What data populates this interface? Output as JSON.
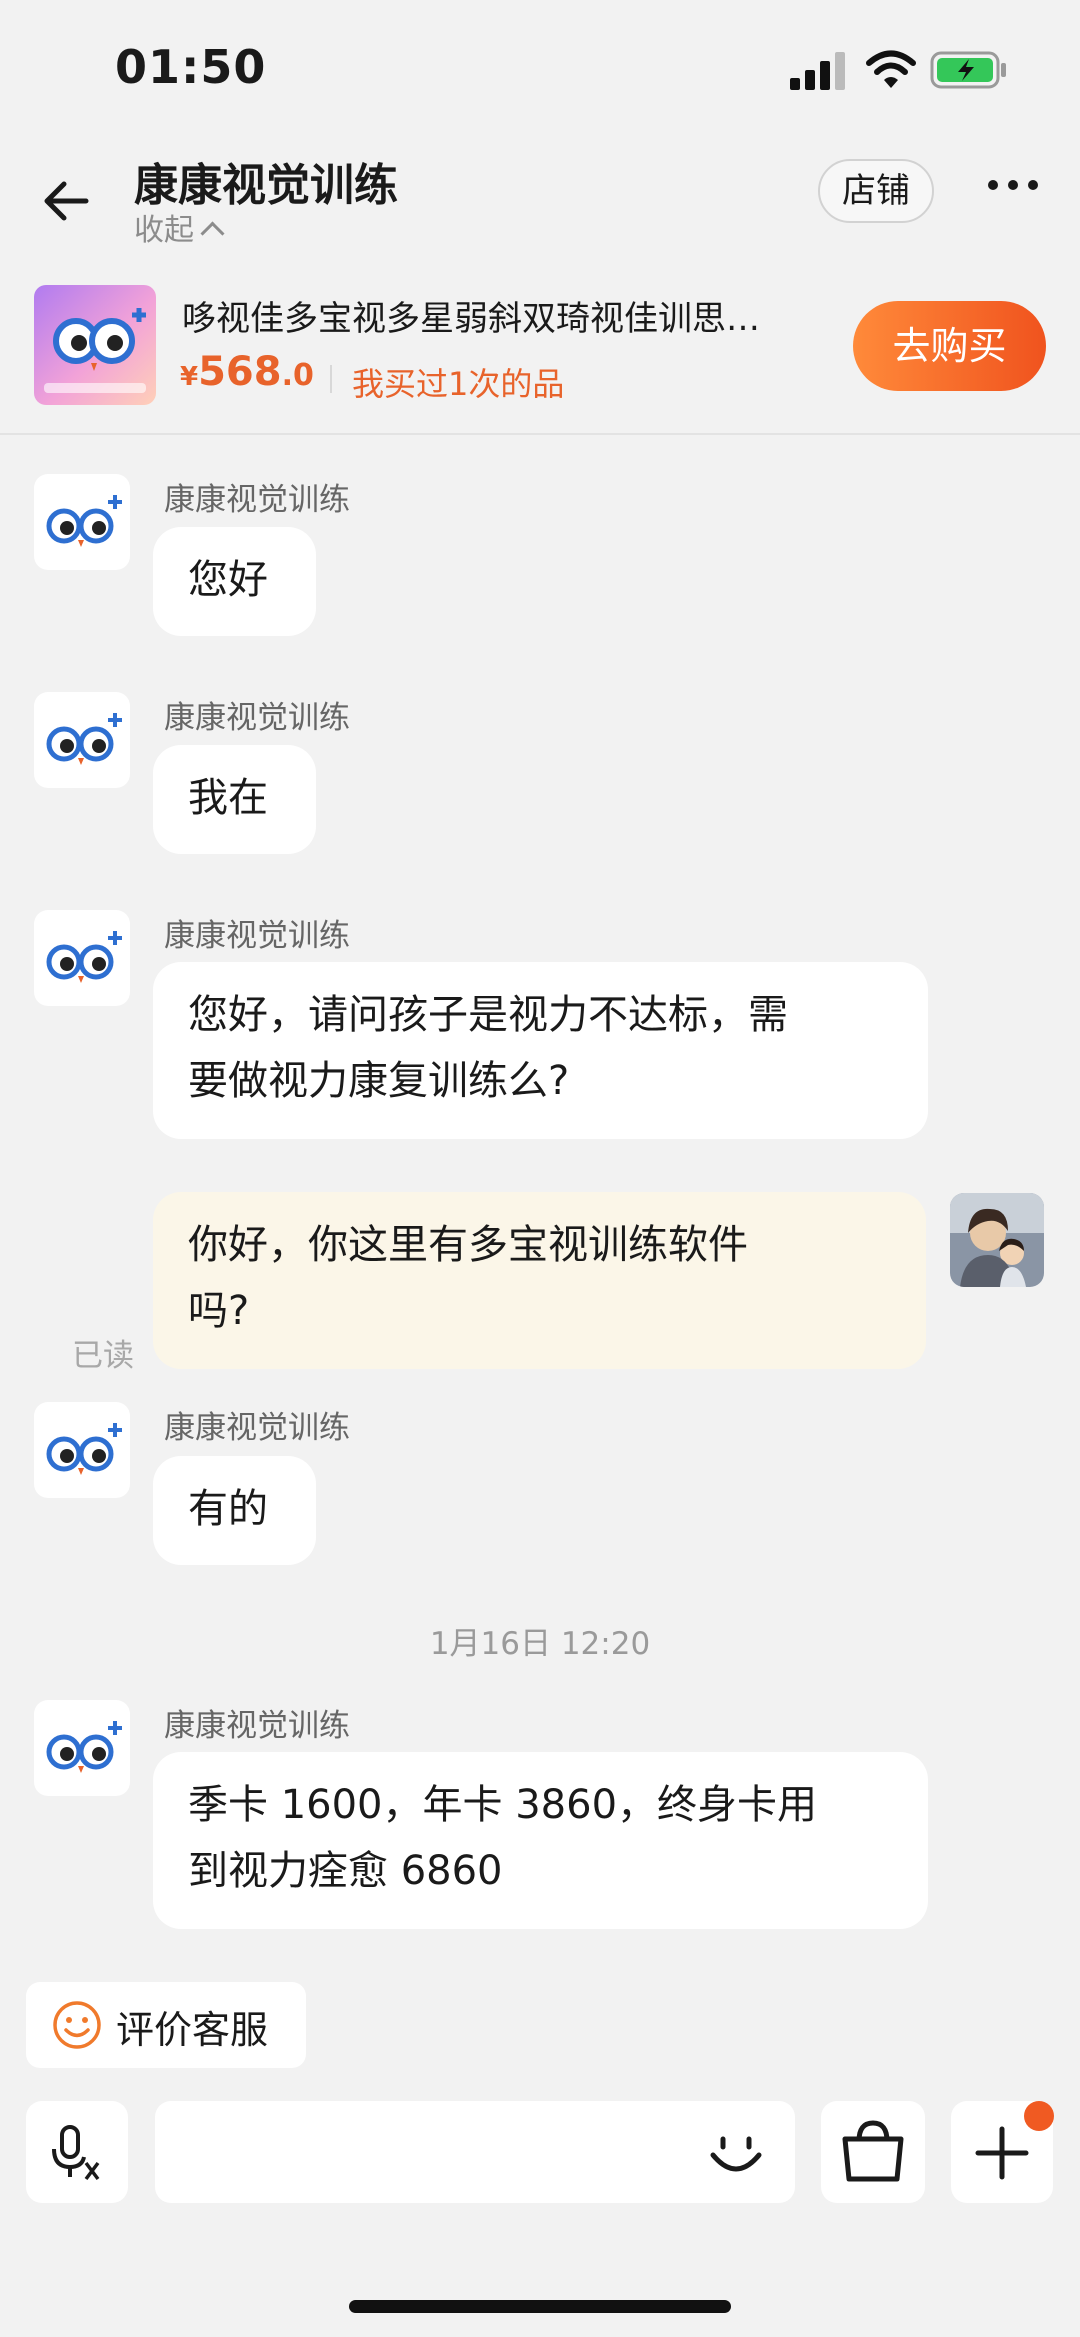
{
  "status_bar": {
    "time": "01:50"
  },
  "header": {
    "title": "康康视觉训练",
    "collapse_label": "收起",
    "store_label": "店铺"
  },
  "product": {
    "name": "哆视佳多宝视多星弱斜双琦视佳训思…",
    "currency": "¥",
    "price_int": "568",
    "price_dec": ".0",
    "purchased_note": "我买过1次的品",
    "buy_label": "去购买"
  },
  "messages": [
    {
      "from": "shop",
      "sender": "康康视觉训练",
      "text": "您好"
    },
    {
      "from": "shop",
      "sender": "康康视觉训练",
      "text": "我在"
    },
    {
      "from": "shop",
      "sender": "康康视觉训练",
      "lines": [
        "您好，请问孩子是视力不达标，需",
        "要做视力康复训练么?"
      ]
    },
    {
      "from": "me",
      "lines": [
        "你好，你这里有多宝视训练软件",
        "吗?"
      ],
      "status": "已读"
    },
    {
      "from": "shop",
      "sender": "康康视觉训练",
      "text": "有的"
    },
    {
      "from": "shop",
      "sender": "康康视觉训练",
      "lines": [
        "季卡 1600，年卡 3860，终身卡用",
        "到视力痊愈 6860"
      ]
    }
  ],
  "timestamp": "1月16日 12:20",
  "rate_service_label": "评价客服",
  "colors": {
    "accent": "#f05a22",
    "bubble_me": "#fbf6e8",
    "bubble_shop": "#ffffff"
  }
}
